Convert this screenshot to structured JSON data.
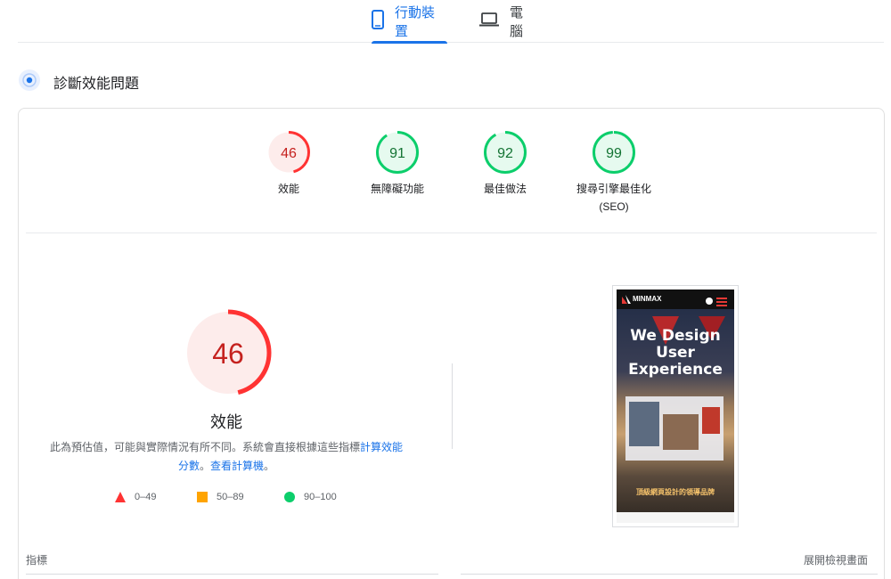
{
  "tabs": {
    "mobile_label": "行動裝置",
    "desktop_label": "電腦"
  },
  "section": {
    "title": "診斷效能問題"
  },
  "gauges": [
    {
      "score": 46,
      "label": "效能",
      "sublabel": "",
      "color": "#f33",
      "fill": "#fdeceb",
      "text_color": "#c5221f"
    },
    {
      "score": 91,
      "label": "無障礙功能",
      "sublabel": "",
      "color": "#0cce6b",
      "fill": "#e6faef",
      "text_color": "#137333"
    },
    {
      "score": 92,
      "label": "最佳做法",
      "sublabel": "",
      "color": "#0cce6b",
      "fill": "#e6faef",
      "text_color": "#137333"
    },
    {
      "score": 99,
      "label": "搜尋引擎最佳化",
      "sublabel": "(SEO)",
      "color": "#0cce6b",
      "fill": "#e6faef",
      "text_color": "#137333"
    }
  ],
  "performance": {
    "score": 46,
    "title": "效能",
    "desc_prefix": "此為預估值，可能與實際情況有所不同。系統會直接根據這些指標",
    "link1": "計算效能分數",
    "desc_mid": "。",
    "link2": "查看計算機",
    "desc_suffix": "。"
  },
  "legend": [
    {
      "range": "0–49",
      "color": "#f33",
      "shape": "triangle"
    },
    {
      "range": "50–89",
      "color": "#ffa400",
      "shape": "square"
    },
    {
      "range": "90–100",
      "color": "#0cce6b",
      "shape": "circle"
    }
  ],
  "thumbnail": {
    "brand": "MINMAX",
    "headline_1": "We Design",
    "headline_2": "User",
    "headline_3": "Experience",
    "tagline": "頂級網頁設計的領導品牌"
  },
  "footer": {
    "metrics_label": "指標",
    "expand_label": "展開檢視畫面"
  }
}
